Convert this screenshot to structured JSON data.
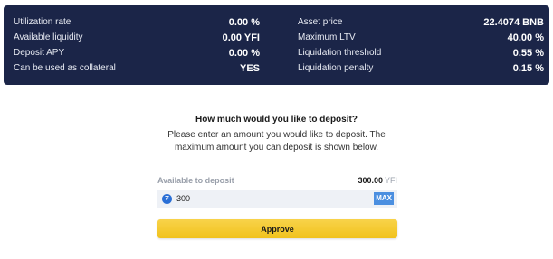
{
  "stats": {
    "left": [
      {
        "label": "Utilization rate",
        "value": "0.00 %"
      },
      {
        "label": "Available liquidity",
        "value": "0.00 YFI"
      },
      {
        "label": "Deposit APY",
        "value": "0.00 %"
      },
      {
        "label": "Can be used as collateral",
        "value": "YES"
      }
    ],
    "right": [
      {
        "label": "Asset price",
        "value": "22.4074 BNB"
      },
      {
        "label": "Maximum LTV",
        "value": "40.00 %"
      },
      {
        "label": "Liquidation threshold",
        "value": "0.55 %"
      },
      {
        "label": "Liquidation penalty",
        "value": "0.15 %"
      }
    ]
  },
  "deposit": {
    "title": "How much would you like to deposit?",
    "description": "Please enter an amount you would like to deposit. The maximum amount you can deposit is shown below.",
    "available_label": "Available to deposit",
    "available_amount": "300.00",
    "available_unit": "YFI",
    "amount_value": "300",
    "max_label": "MAX",
    "approve_label": "Approve"
  },
  "colors": {
    "panel_bg": "#1b2548",
    "button_yellow": "#f1c21c",
    "max_blue": "#4b8fe0",
    "token_icon": "#2a6fd6"
  },
  "icons": {
    "token": "yfi-token-icon"
  }
}
